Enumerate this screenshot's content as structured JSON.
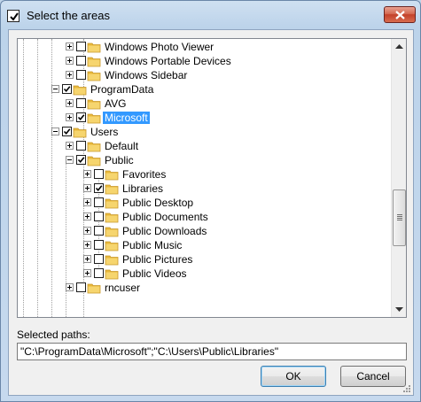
{
  "window": {
    "title": "Select the areas"
  },
  "tree": {
    "rows": [
      {
        "label": "Windows Photo Viewer",
        "checked": false,
        "expanded": false,
        "level": 3,
        "selected": false
      },
      {
        "label": "Windows Portable Devices",
        "checked": false,
        "expanded": false,
        "level": 3,
        "selected": false
      },
      {
        "label": "Windows Sidebar",
        "checked": false,
        "expanded": false,
        "level": 3,
        "selected": false
      },
      {
        "label": "ProgramData",
        "checked": "partial",
        "expanded": true,
        "level": 2,
        "selected": false
      },
      {
        "label": "AVG",
        "checked": false,
        "expanded": false,
        "level": 3,
        "selected": false
      },
      {
        "label": "Microsoft",
        "checked": true,
        "expanded": false,
        "level": 3,
        "selected": true
      },
      {
        "label": "Users",
        "checked": "partial",
        "expanded": true,
        "level": 2,
        "selected": false
      },
      {
        "label": "Default",
        "checked": false,
        "expanded": false,
        "level": 3,
        "selected": false
      },
      {
        "label": "Public",
        "checked": "partial",
        "expanded": true,
        "level": 3,
        "selected": false
      },
      {
        "label": "Favorites",
        "checked": false,
        "expanded": false,
        "level": 4,
        "selected": false
      },
      {
        "label": "Libraries",
        "checked": true,
        "expanded": false,
        "level": 4,
        "selected": false
      },
      {
        "label": "Public Desktop",
        "checked": false,
        "expanded": false,
        "level": 4,
        "selected": false
      },
      {
        "label": "Public Documents",
        "checked": false,
        "expanded": false,
        "level": 4,
        "selected": false
      },
      {
        "label": "Public Downloads",
        "checked": false,
        "expanded": false,
        "level": 4,
        "selected": false
      },
      {
        "label": "Public Music",
        "checked": false,
        "expanded": false,
        "level": 4,
        "selected": false
      },
      {
        "label": "Public Pictures",
        "checked": false,
        "expanded": false,
        "level": 4,
        "selected": false
      },
      {
        "label": "Public Videos",
        "checked": false,
        "expanded": false,
        "level": 4,
        "selected": false
      },
      {
        "label": "rncuser",
        "checked": false,
        "expanded": false,
        "level": 3,
        "selected": false
      }
    ]
  },
  "selected_paths": {
    "label": "Selected paths:",
    "value": "\"C:\\ProgramData\\Microsoft\";\"C:\\Users\\Public\\Libraries\""
  },
  "buttons": {
    "ok": "OK",
    "cancel": "Cancel"
  },
  "colors": {
    "selection": "#3399ff",
    "folder": "#f2c94c",
    "close": "#c3412a"
  }
}
